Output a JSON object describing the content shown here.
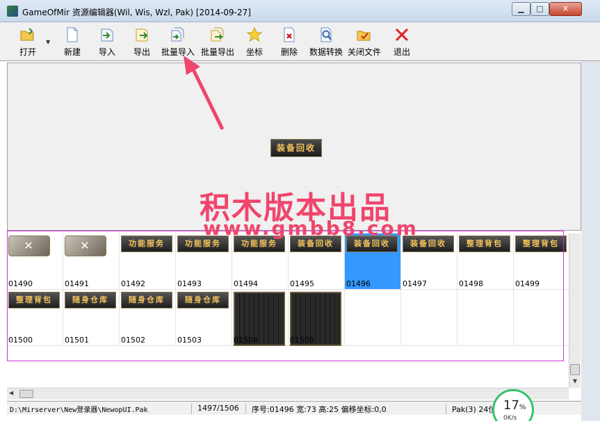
{
  "window": {
    "title": "GameOfMir 资源编辑器(Wil, Wis, Wzl, Pak) [2014-09-27]",
    "minimize_glyph": "▁",
    "maximize_glyph": "□",
    "close_glyph": "✕"
  },
  "toolbar": {
    "items": [
      {
        "label": "打开",
        "icon": "open-folder-icon"
      },
      {
        "label": "新建",
        "icon": "new-file-icon"
      },
      {
        "label": "导入",
        "icon": "import-icon"
      },
      {
        "label": "导出",
        "icon": "export-icon"
      },
      {
        "label": "批量导入",
        "icon": "batch-import-icon"
      },
      {
        "label": "批量导出",
        "icon": "batch-export-icon"
      },
      {
        "label": "坐标",
        "icon": "star-icon"
      },
      {
        "label": "删除",
        "icon": "delete-icon"
      },
      {
        "label": "数据转换",
        "icon": "convert-icon"
      },
      {
        "label": "关闭文件",
        "icon": "close-file-icon"
      },
      {
        "label": "退出",
        "icon": "exit-icon"
      }
    ],
    "dropdown_glyph": "▼"
  },
  "preview": {
    "image_text": "装备回收"
  },
  "watermark": {
    "text_cn": "积木版本出品",
    "url": "www.gmbb8.com"
  },
  "grid": {
    "cells": [
      {
        "id": "01490",
        "image": "icon",
        "text": "✕"
      },
      {
        "id": "01491",
        "image": "icon",
        "text": "✕"
      },
      {
        "id": "01492",
        "image": "button",
        "text": "功能服务"
      },
      {
        "id": "01493",
        "image": "button",
        "text": "功能服务"
      },
      {
        "id": "01494",
        "image": "button",
        "text": "功能服务"
      },
      {
        "id": "01495",
        "image": "button",
        "text": "装备回收"
      },
      {
        "id": "01496",
        "image": "button",
        "text": "装备回收",
        "selected": true
      },
      {
        "id": "01497",
        "image": "button",
        "text": "装备回收"
      },
      {
        "id": "01498",
        "image": "button",
        "text": "整理背包"
      },
      {
        "id": "01499",
        "image": "button",
        "text": "整理背包"
      },
      {
        "id": "01500",
        "image": "button",
        "text": "整理背包"
      },
      {
        "id": "01501",
        "image": "button",
        "text": "随身仓库"
      },
      {
        "id": "01502",
        "image": "button",
        "text": "随身仓库"
      },
      {
        "id": "01503",
        "image": "button",
        "text": "随身仓库"
      },
      {
        "id": "01504",
        "image": "panel",
        "text": ""
      },
      {
        "id": "01505",
        "image": "panel",
        "text": ""
      },
      {
        "id": "",
        "image": "empty",
        "text": ""
      },
      {
        "id": "",
        "image": "empty",
        "text": ""
      },
      {
        "id": "",
        "image": "empty",
        "text": ""
      },
      {
        "id": "",
        "image": "empty",
        "text": ""
      }
    ]
  },
  "status": {
    "path": "D:\\Mirserver\\New登录器\\NewopUI.Pak",
    "count": "1497/1506",
    "info": "序号:01496 宽:73 高:25 偏移坐标:0,0",
    "format": "Pak(3) 24位"
  },
  "meter": {
    "percent": "17",
    "percent_sign": "%",
    "rate": "0K/s"
  },
  "colors": {
    "selection": "#3399ff",
    "watermark": "#f0456d",
    "annotation_arrow": "#f0456d",
    "grid_border": "#cc33cc"
  }
}
